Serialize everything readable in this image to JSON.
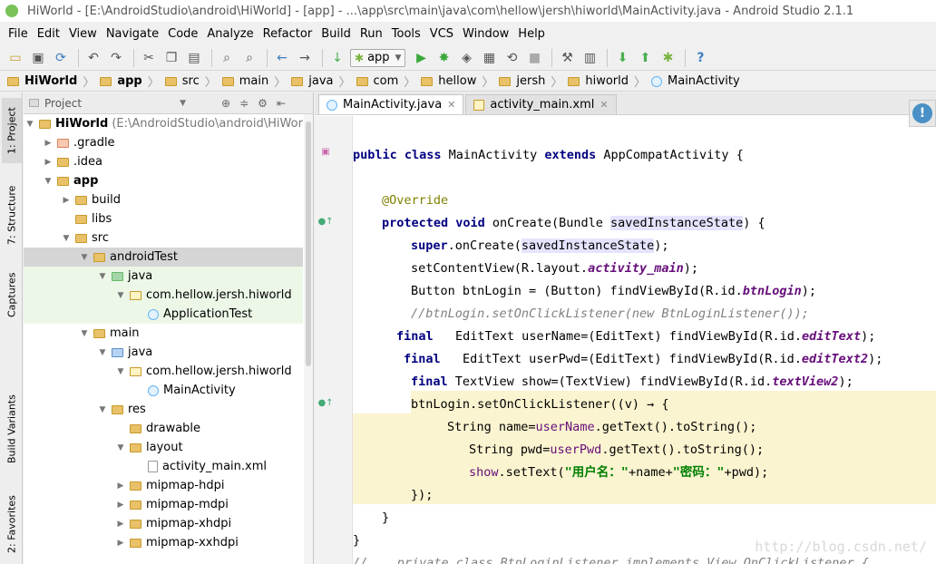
{
  "window": {
    "title": "HiWorld - [E:\\AndroidStudio\\android\\HiWorld] - [app] - ...\\app\\src\\main\\java\\com\\hellow\\jersh\\hiworld\\MainActivity.java - Android Studio 2.1.1"
  },
  "menu": [
    "File",
    "Edit",
    "View",
    "Navigate",
    "Code",
    "Analyze",
    "Refactor",
    "Build",
    "Run",
    "Tools",
    "VCS",
    "Window",
    "Help"
  ],
  "toolbar": {
    "run_config": "app"
  },
  "breadcrumb": [
    "HiWorld",
    "app",
    "src",
    "main",
    "java",
    "com",
    "hellow",
    "jersh",
    "hiworld",
    "MainActivity"
  ],
  "left_strip": [
    "1: Project",
    "7: Structure",
    "Captures",
    "Build Variants",
    "2: Favorites"
  ],
  "project": {
    "header": "Project",
    "tree": [
      {
        "label": "HiWorld",
        "suffix": "(E:\\AndroidStudio\\android\\HiWorld)"
      },
      {
        "label": ".gradle"
      },
      {
        "label": ".idea"
      },
      {
        "label": "app"
      },
      {
        "label": "build"
      },
      {
        "label": "libs"
      },
      {
        "label": "src"
      },
      {
        "label": "androidTest"
      },
      {
        "label": "java"
      },
      {
        "label": "com.hellow.jersh.hiworld"
      },
      {
        "label": "ApplicationTest"
      },
      {
        "label": "main"
      },
      {
        "label": "java"
      },
      {
        "label": "com.hellow.jersh.hiworld"
      },
      {
        "label": "MainActivity"
      },
      {
        "label": "res"
      },
      {
        "label": "drawable"
      },
      {
        "label": "layout"
      },
      {
        "label": "activity_main.xml"
      },
      {
        "label": "mipmap-hdpi"
      },
      {
        "label": "mipmap-mdpi"
      },
      {
        "label": "mipmap-xhdpi"
      },
      {
        "label": "mipmap-xxhdpi"
      }
    ]
  },
  "editor": {
    "tabs": [
      {
        "label": "MainActivity.java"
      },
      {
        "label": "activity_main.xml"
      }
    ],
    "code": {
      "l1": [
        "public class ",
        "MainActivity ",
        "extends ",
        "AppCompatActivity {"
      ],
      "l2": "@Override",
      "l3": [
        "protected void ",
        "onCreate(Bundle ",
        "savedInstanceState",
        ") {"
      ],
      "l4": [
        "super",
        ".onCreate(",
        "savedInstanceState",
        ");"
      ],
      "l5": [
        "setContentView(R.layout.",
        "activity_main",
        ");"
      ],
      "l6": [
        "Button btnLogin = (Button) findViewById(R.id.",
        "btnLogin",
        ");"
      ],
      "l7": "//btnLogin.setOnClickListener(new BtnLoginListener());",
      "l8": [
        "final ",
        "  EditText userName=(EditText) findViewById(R.id.",
        "editText",
        ");"
      ],
      "l9": [
        "final ",
        "  EditText userPwd=(EditText) findViewById(R.id.",
        "editText2",
        ");"
      ],
      "l10": [
        "final ",
        "TextView show=(TextView) findViewById(R.id.",
        "textView2",
        ");"
      ],
      "l11": "btnLogin.setOnClickListener((v) → {",
      "l12": [
        "String name=",
        "userName",
        ".getText().toString();"
      ],
      "l13": [
        "String pwd=",
        "userPwd",
        ".getText().toString();"
      ],
      "l14": [
        "show",
        ".setText(",
        "\"用户名：\"",
        "+name+",
        "\"密码：\"",
        "+pwd);"
      ],
      "l15": "});",
      "l16": "}",
      "l17": "}",
      "l18": "//    private class BtnLoginListener implements View.OnClickListener {"
    },
    "watermark": "http://blog.csdn.net/"
  }
}
